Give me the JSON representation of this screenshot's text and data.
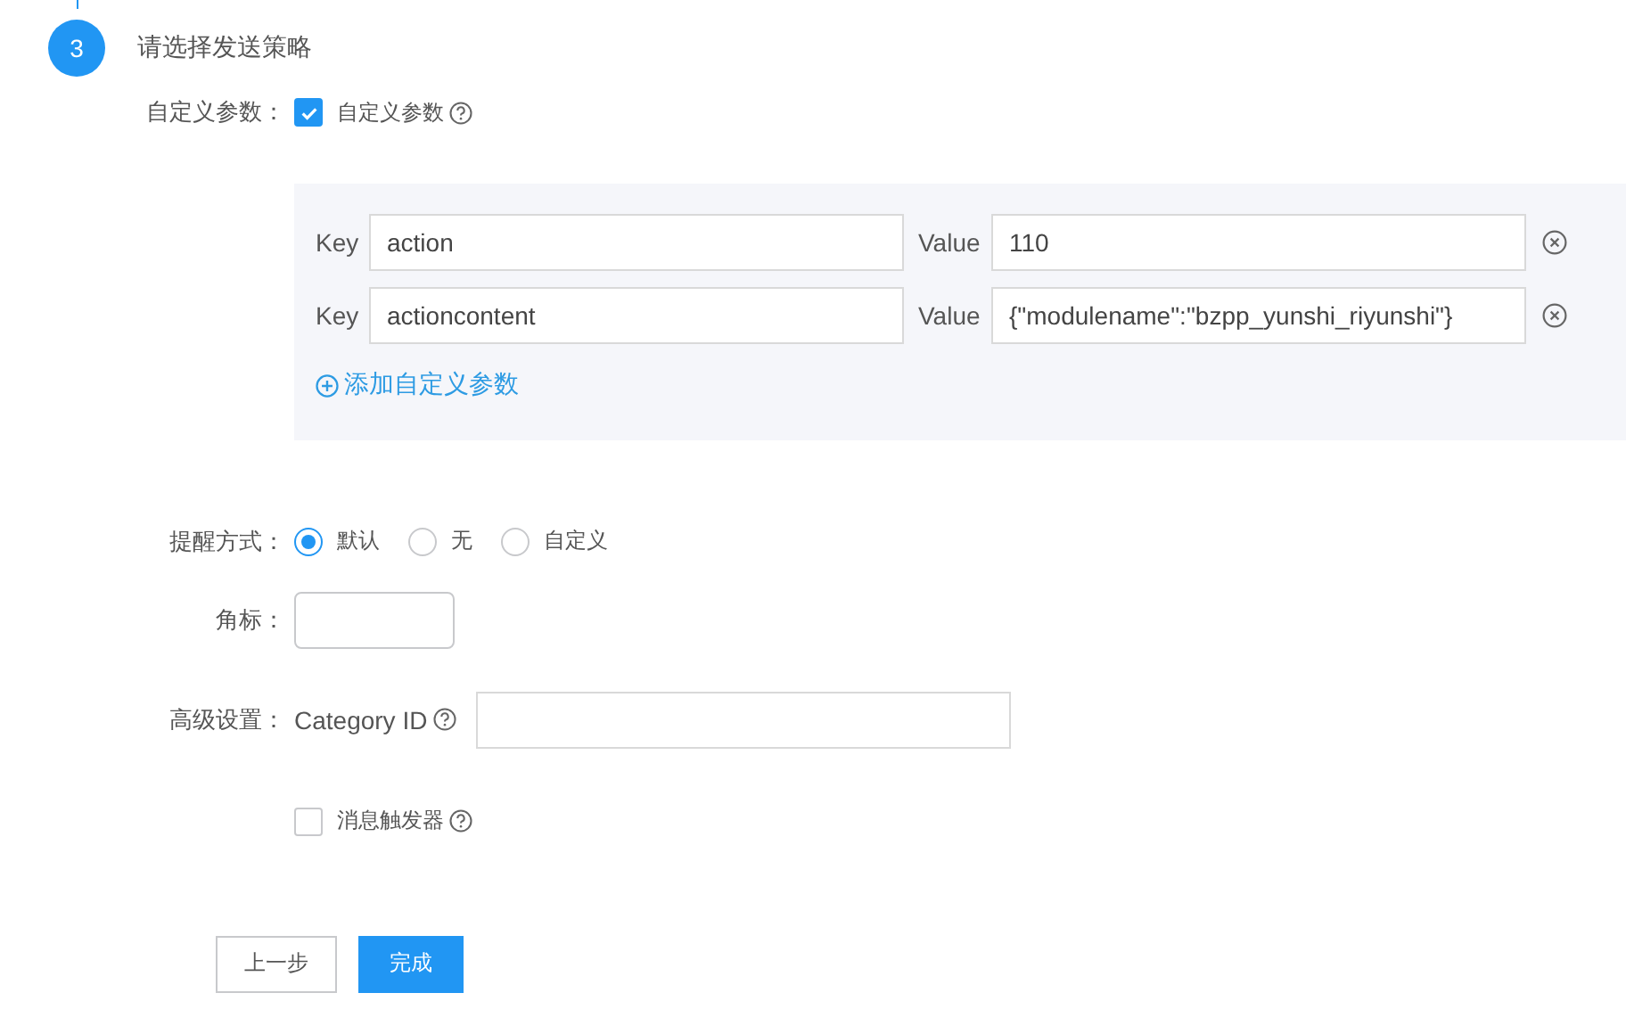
{
  "step": {
    "number": "3",
    "title": "请选择发送策略"
  },
  "custom_params": {
    "label": "自定义参数：",
    "checkbox": {
      "label": "自定义参数",
      "checked": true
    },
    "params": [
      {
        "key_label": "Key",
        "key": "action",
        "value_label": "Value",
        "value": "110"
      },
      {
        "key_label": "Key",
        "key": "actioncontent",
        "value_label": "Value",
        "value": "{\"modulename\":\"bzpp_yunshi_riyunshi\"}"
      }
    ],
    "add_link": "添加自定义参数"
  },
  "reminder": {
    "label": "提醒方式：",
    "options": [
      {
        "label": "默认",
        "selected": true
      },
      {
        "label": "无",
        "selected": false
      },
      {
        "label": "自定义",
        "selected": false
      }
    ]
  },
  "badge": {
    "label": "角标："
  },
  "advanced": {
    "label": "高级设置：",
    "category_label": "Category ID",
    "trigger": {
      "label": "消息触发器",
      "checked": false
    }
  },
  "buttons": [
    {
      "label": "上一步",
      "kind": "secondary"
    },
    {
      "label": "完成",
      "kind": "primary"
    }
  ]
}
